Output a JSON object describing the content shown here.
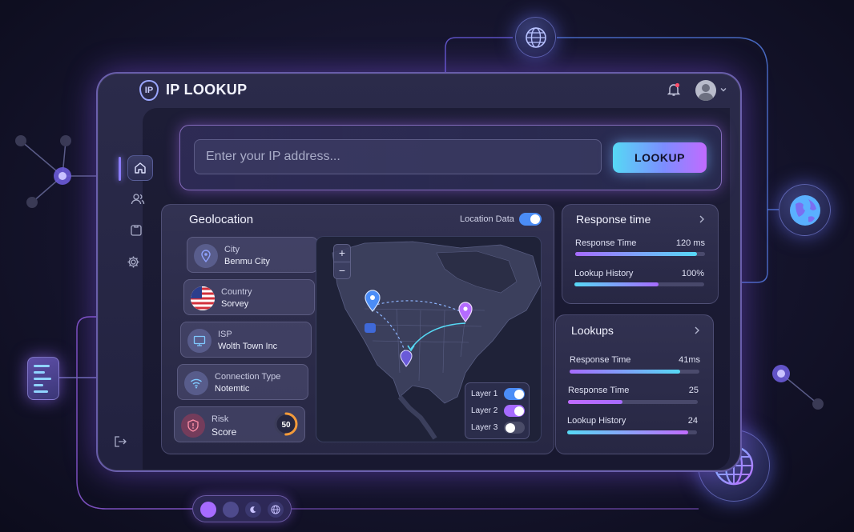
{
  "app": {
    "badge": "IP",
    "title": "IP LOOKUP"
  },
  "search": {
    "placeholder": "Enter your IP address...",
    "button_label": "LOOKUP"
  },
  "geolocation": {
    "title": "Geolocation",
    "location_data_label": "Location Data",
    "location_data_on": true,
    "items": [
      {
        "label": "City",
        "value": "Benmu City",
        "icon": "map-pin-icon"
      },
      {
        "label": "Country",
        "value": "Sorvey",
        "icon": "us-flag-icon"
      },
      {
        "label": "ISP",
        "value": "Wolth Town Inc",
        "icon": "monitor-icon"
      },
      {
        "label": "Connection Type",
        "value": "Notemtic",
        "icon": "wifi-icon"
      }
    ],
    "risk": {
      "label": "Risk",
      "sub_label": "Score",
      "value": "50",
      "score": 50,
      "max": 100
    }
  },
  "map": {
    "zoom_in": "+",
    "zoom_out": "−",
    "layers": [
      {
        "label": "Layer 1",
        "on": true,
        "color": "#4b8df7"
      },
      {
        "label": "Layer 2",
        "on": true,
        "color": "#a66bff"
      },
      {
        "label": "Layer 3",
        "on": false,
        "color": "#4a4c68"
      }
    ]
  },
  "response_time": {
    "title": "Response time",
    "metrics": [
      {
        "label": "Response Time",
        "value": "120 ms",
        "fill": 0.94
      },
      {
        "label": "Lookup History",
        "value": "100%",
        "fill": 0.65
      }
    ]
  },
  "lookups": {
    "title": "Lookups",
    "metrics": [
      {
        "label": "Response Time",
        "value": "41ms",
        "fill": 0.85
      },
      {
        "label": "Response Time",
        "value": "25",
        "fill": 0.42
      },
      {
        "label": "Lookup History",
        "value": "24",
        "fill": 0.93
      }
    ]
  },
  "colors": {
    "accent_purple": "#a66bff",
    "accent_cyan": "#56d9f5",
    "accent_blue": "#4b8df7",
    "risk_orange": "#f39a3a"
  }
}
